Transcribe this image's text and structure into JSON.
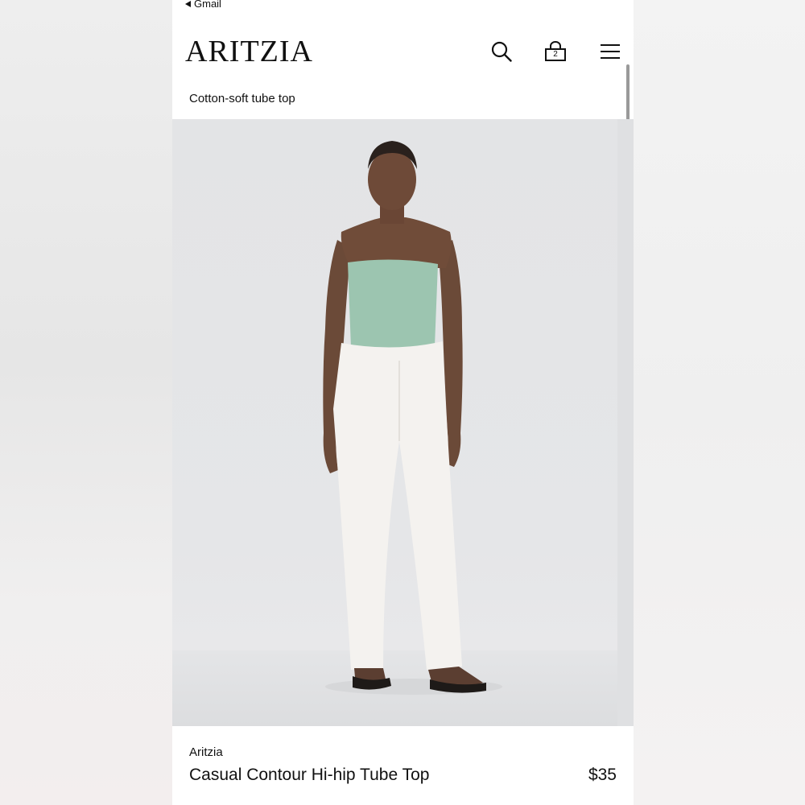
{
  "status_bar": {
    "back_label": "Gmail"
  },
  "header": {
    "logo": "ARITZIA",
    "bag_count": "2",
    "icons": [
      "search-icon",
      "shopping-bag-icon",
      "hamburger-menu-icon"
    ]
  },
  "product": {
    "subtitle": "Cotton-soft tube top",
    "brand": "Aritzia",
    "name": "Casual Contour Hi-hip Tube Top",
    "price": "$35",
    "image": "model-wearing-mint-tube-top-and-white-jeans"
  },
  "colors": {
    "top_color": "#9cc5b0",
    "jeans_color": "#f4f2ef",
    "background": "#ffffff",
    "text": "#111111"
  }
}
